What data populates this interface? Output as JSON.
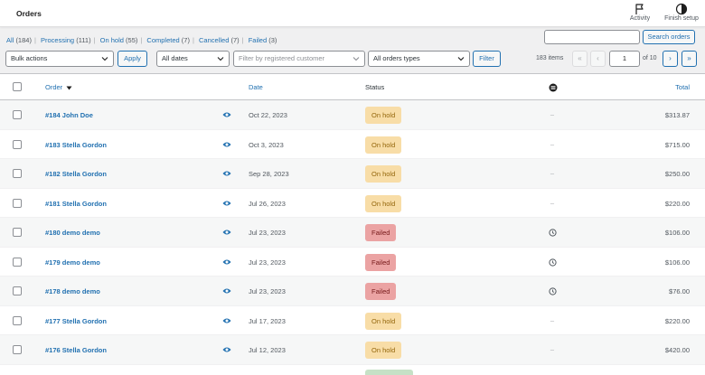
{
  "header": {
    "title": "Orders",
    "activity_label": "Activity",
    "finish_setup_label": "Finish setup"
  },
  "views": [
    {
      "label": "All",
      "count": "(184)"
    },
    {
      "label": "Processing",
      "count": "(111)"
    },
    {
      "label": "On hold",
      "count": "(55)"
    },
    {
      "label": "Completed",
      "count": "(7)"
    },
    {
      "label": "Cancelled",
      "count": "(7)"
    },
    {
      "label": "Failed",
      "count": "(3)"
    }
  ],
  "search": {
    "value": "",
    "button_label": "Search orders"
  },
  "filters": {
    "bulk_actions": "Bulk actions",
    "apply_label": "Apply",
    "dates": "All dates",
    "customer_placeholder": "Filter by registered customer",
    "order_types": "All orders types",
    "filter_label": "Filter"
  },
  "pagination": {
    "items": "183 items",
    "first": "«",
    "prev": "‹",
    "current": "1",
    "of": "of 10",
    "next": "›",
    "last": "»"
  },
  "columns": {
    "order": "Order",
    "date": "Date",
    "status": "Status",
    "total": "Total"
  },
  "orders": [
    {
      "name": "#184 John Doe",
      "date": "Oct 22, 2023",
      "status": "On hold",
      "status_key": "onhold",
      "origin": "–",
      "total": "$313.87"
    },
    {
      "name": "#183 Stella Gordon",
      "date": "Oct 3, 2023",
      "status": "On hold",
      "status_key": "onhold",
      "origin": "–",
      "total": "$715.00"
    },
    {
      "name": "#182 Stella Gordon",
      "date": "Sep 28, 2023",
      "status": "On hold",
      "status_key": "onhold",
      "origin": "–",
      "total": "$250.00"
    },
    {
      "name": "#181 Stella Gordon",
      "date": "Jul 26, 2023",
      "status": "On hold",
      "status_key": "onhold",
      "origin": "–",
      "total": "$220.00"
    },
    {
      "name": "#180 demo demo",
      "date": "Jul 23, 2023",
      "status": "Failed",
      "status_key": "failed",
      "origin": "clock-icon",
      "total": "$106.00"
    },
    {
      "name": "#179 demo demo",
      "date": "Jul 23, 2023",
      "status": "Failed",
      "status_key": "failed",
      "origin": "clock-icon",
      "total": "$106.00"
    },
    {
      "name": "#178 demo demo",
      "date": "Jul 23, 2023",
      "status": "Failed",
      "status_key": "failed",
      "origin": "clock-icon",
      "total": "$76.00"
    },
    {
      "name": "#177 Stella Gordon",
      "date": "Jul 17, 2023",
      "status": "On hold",
      "status_key": "onhold",
      "origin": "–",
      "total": "$220.00"
    },
    {
      "name": "#176 Stella Gordon",
      "date": "Jul 12, 2023",
      "status": "On hold",
      "status_key": "onhold",
      "origin": "–",
      "total": "$420.00"
    }
  ],
  "icons": {
    "activity": "flag-icon",
    "finish_setup": "half-circle-icon",
    "origin_column": "origin-icon",
    "preview": "eye-icon",
    "sort": "sort-down-icon"
  },
  "colors": {
    "accent": "#2271b1",
    "onhold_bg": "#f8dda7",
    "onhold_text": "#94660c",
    "failed_bg": "#eba3a3",
    "failed_text": "#761919",
    "completed_bg": "#c6e1c6"
  }
}
